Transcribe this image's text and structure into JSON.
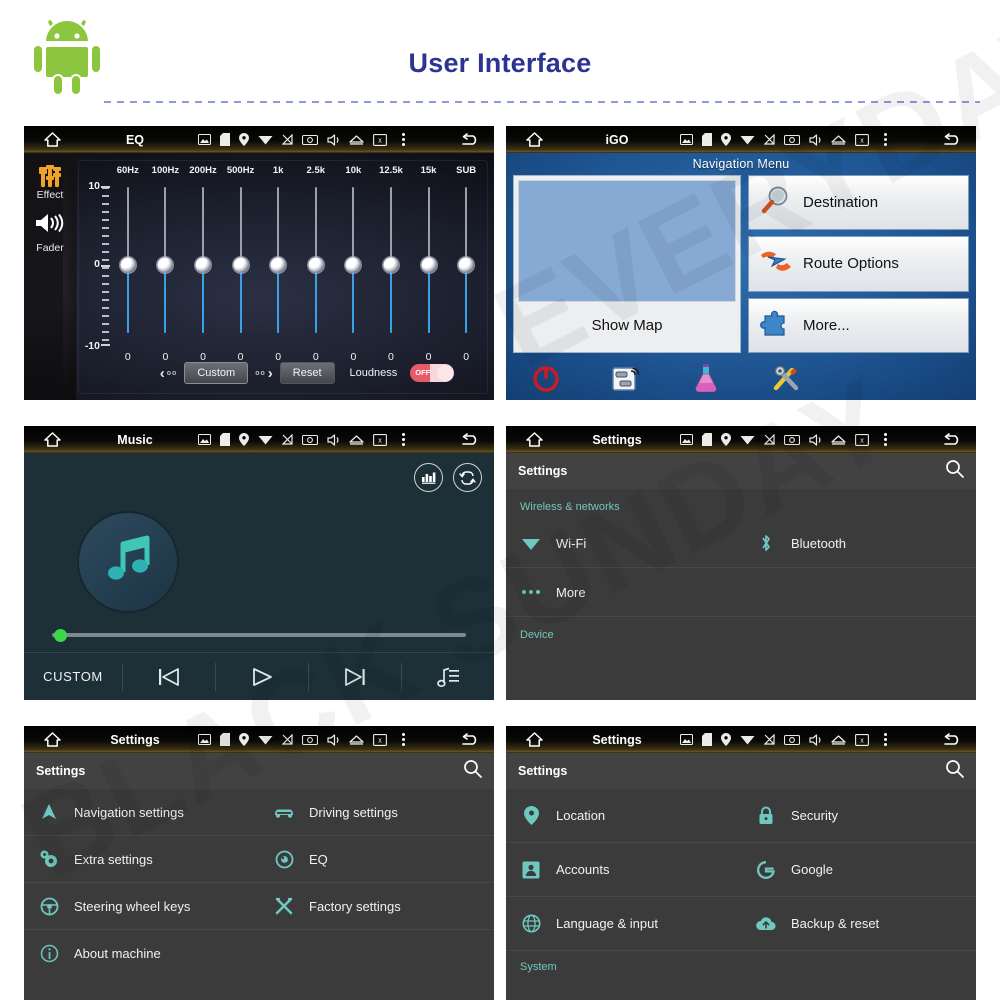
{
  "header": {
    "title": "User Interface",
    "logo_icon": "android-robot-icon",
    "title_color": "#2b3490"
  },
  "watermark": {
    "line1": "BLACK SUNDAY",
    "line2": "EVERYDAY"
  },
  "statusbar": {
    "home_icon": "home-icon",
    "back_icon": "back-arrow-icon",
    "overflow_icon": "overflow-menu-icon",
    "icons": [
      "image-icon",
      "sd-card-icon",
      "location-pin-icon",
      "wifi-icon",
      "signal-off-icon",
      "screenshot-icon",
      "volume-icon",
      "eject-icon",
      "close-box-icon"
    ]
  },
  "panels": {
    "eq": {
      "title": "EQ",
      "sidebar": [
        {
          "label": "Effect",
          "icon": "equalizer-sliders-icon",
          "active": true
        },
        {
          "label": "Fader",
          "icon": "speaker-icon",
          "active": false
        }
      ],
      "axis": {
        "max_label": "10",
        "mid_label": "0",
        "min_label": "-10",
        "max": 10,
        "min": -10
      },
      "bands": [
        {
          "label": "60Hz",
          "value": 0
        },
        {
          "label": "100Hz",
          "value": 0
        },
        {
          "label": "200Hz",
          "value": 0
        },
        {
          "label": "500Hz",
          "value": 0
        },
        {
          "label": "1k",
          "value": 0
        },
        {
          "label": "2.5k",
          "value": 0
        },
        {
          "label": "10k",
          "value": 0
        },
        {
          "label": "12.5k",
          "value": 0
        },
        {
          "label": "15k",
          "value": 0
        },
        {
          "label": "SUB",
          "value": 0
        }
      ],
      "controls": {
        "prev_preset": "‹",
        "preset_name": "Custom",
        "next_preset": "›",
        "reset_label": "Reset",
        "loudness_label": "Loudness",
        "loudness_state": "OFF"
      },
      "colors": {
        "slider_fill": "#3aa0e8",
        "effect_icon": "#f0a22a"
      }
    },
    "igo": {
      "title": "iGO",
      "menu_title": "Navigation Menu",
      "show_map_label": "Show Map",
      "buttons": [
        {
          "label": "Destination",
          "icon": "magnifier-icon"
        },
        {
          "label": "Route Options",
          "icon": "route-arrow-icon"
        },
        {
          "label": "More...",
          "icon": "puzzle-piece-icon"
        }
      ],
      "toolbar": [
        {
          "icon": "power-icon"
        },
        {
          "icon": "gps-traffic-icon"
        },
        {
          "icon": "flask-icon"
        },
        {
          "icon": "tools-icon"
        }
      ]
    },
    "music": {
      "title": "Music",
      "album_art_icon": "music-note-icon",
      "top_buttons": [
        {
          "icon": "equalizer-icon"
        },
        {
          "icon": "repeat-icon"
        }
      ],
      "progress_percent": 1,
      "eq_preset_label": "CUSTOM",
      "transport": [
        {
          "icon": "previous-track-icon"
        },
        {
          "icon": "play-icon"
        },
        {
          "icon": "next-track-icon"
        }
      ],
      "playlist_icon": "playlist-icon",
      "colors": {
        "background": "#1d3038",
        "accent": "#3ad94a",
        "note": "#3fc6b9"
      }
    },
    "settings_wireless": {
      "title": "Settings",
      "subtitle": "Settings",
      "search_icon": "search-icon",
      "groups": [
        {
          "name": "Wireless & networks",
          "items": [
            {
              "label": "Wi-Fi",
              "icon": "wifi-icon"
            },
            {
              "label": "Bluetooth",
              "icon": "bluetooth-icon"
            },
            {
              "label": "More",
              "icon": "more-dots-icon"
            }
          ]
        },
        {
          "name": "Device",
          "items": []
        }
      ]
    },
    "settings_device": {
      "title": "Settings",
      "subtitle": "Settings",
      "search_icon": "search-icon",
      "items": [
        {
          "label": "Navigation settings",
          "icon": "navigation-arrow-icon"
        },
        {
          "label": "Driving settings",
          "icon": "car-icon"
        },
        {
          "label": "Extra settings",
          "icon": "gears-icon"
        },
        {
          "label": "EQ",
          "icon": "speaker-round-icon"
        },
        {
          "label": "Steering wheel keys",
          "icon": "steering-wheel-icon"
        },
        {
          "label": "Factory settings",
          "icon": "tools-cross-icon"
        },
        {
          "label": "About machine",
          "icon": "info-icon"
        }
      ]
    },
    "settings_personal": {
      "title": "Settings",
      "subtitle": "Settings",
      "search_icon": "search-icon",
      "items": [
        {
          "label": "Location",
          "icon": "location-pin-icon"
        },
        {
          "label": "Security",
          "icon": "lock-icon"
        },
        {
          "label": "Accounts",
          "icon": "account-icon"
        },
        {
          "label": "Google",
          "icon": "google-g-icon"
        },
        {
          "label": "Language & input",
          "icon": "globe-icon"
        },
        {
          "label": "Backup & reset",
          "icon": "cloud-upload-icon"
        }
      ],
      "footer_group": "System"
    }
  },
  "theme": {
    "settings_bg": "#3b3b3b",
    "settings_header_bg": "#424242",
    "settings_accent": "#73c7bd"
  }
}
